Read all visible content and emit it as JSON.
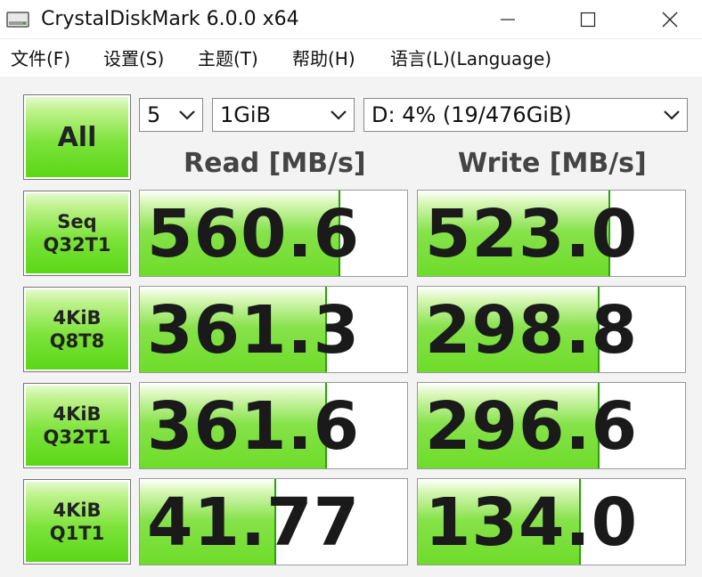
{
  "window": {
    "title": "CrystalDiskMark 6.0.0 x64",
    "icon": "hard-drive-icon"
  },
  "menu": [
    {
      "label": "文件(F)"
    },
    {
      "label": "设置(S)"
    },
    {
      "label": "主题(T)"
    },
    {
      "label": "帮助(H)"
    },
    {
      "label": "语言(L)(Language)"
    }
  ],
  "controls": {
    "all_label": "All",
    "count": "5",
    "size": "1GiB",
    "drive": "D: 4% (19/476GiB)"
  },
  "headers": {
    "read": "Read [MB/s]",
    "write": "Write [MB/s]"
  },
  "tests": [
    {
      "line1": "Seq",
      "line2": "Q32T1",
      "read": "560.6",
      "write": "523.0",
      "read_fill": 0.75,
      "write_fill": 0.72
    },
    {
      "line1": "4KiB",
      "line2": "Q8T8",
      "read": "361.3",
      "write": "298.8",
      "read_fill": 0.7,
      "write_fill": 0.68
    },
    {
      "line1": "4KiB",
      "line2": "Q32T1",
      "read": "361.6",
      "write": "296.6",
      "read_fill": 0.7,
      "write_fill": 0.68
    },
    {
      "line1": "4KiB",
      "line2": "Q1T1",
      "read": "41.77",
      "write": "134.0",
      "read_fill": 0.51,
      "write_fill": 0.61
    }
  ],
  "colors": {
    "bar_green": "#6edc2a",
    "button_green": "#58d615"
  }
}
